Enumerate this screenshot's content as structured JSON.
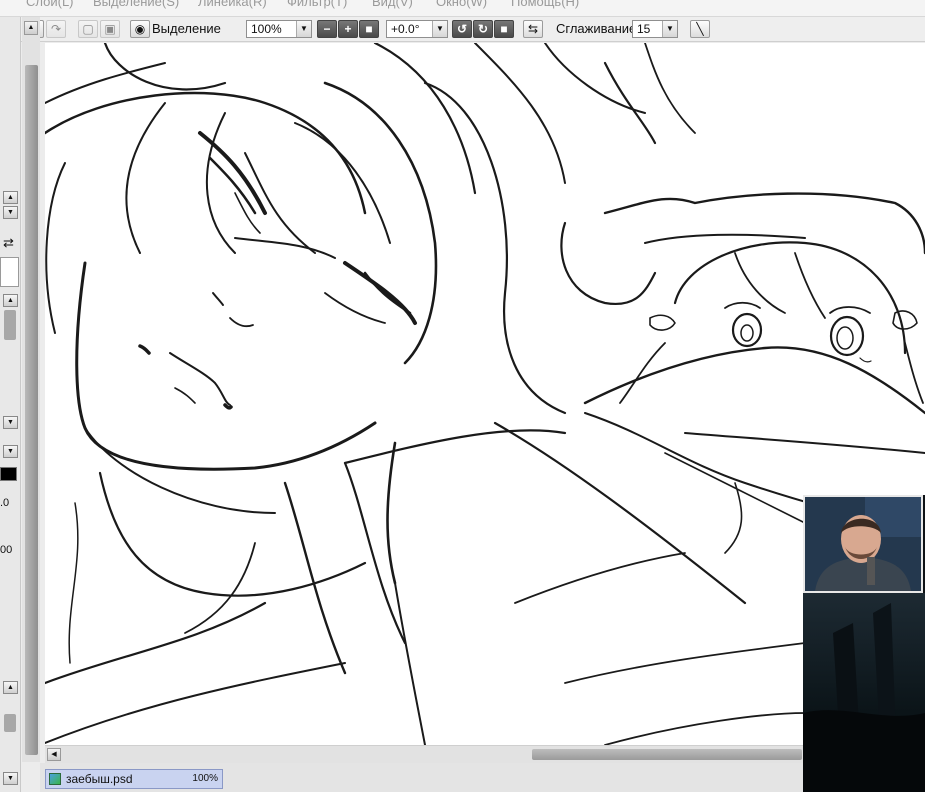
{
  "menubar": {
    "items": [
      "Слои(L)",
      "Выделение(S)",
      "Линейка(R)",
      "Фильтр(T)",
      "Вид(V)",
      "Окно(W)",
      "Помощь(H)"
    ]
  },
  "toolbar": {
    "selection_label": "Выделение",
    "zoom_value": "100%",
    "rotation_value": "+0.0°",
    "smoothing_label": "Сглаживание",
    "smoothing_value": "15"
  },
  "left_panel": {
    "value_1": ".0",
    "value_2": "00"
  },
  "document_tab": {
    "filename": "заебыш.psd",
    "zoom": "100%"
  },
  "icons": {
    "undo": "undo-icon",
    "redo": "redo-icon",
    "eye": "eye-icon",
    "zoom_out": "minus-icon",
    "zoom_in": "plus-icon",
    "rotate_ccw": "rotate-left-icon",
    "rotate_cw": "rotate-right-icon",
    "flip": "flip-horizontal-icon",
    "pen": "pen-stroke-icon"
  },
  "colors": {
    "doc_tab_bg": "#c9d3f0",
    "canvas_bg": "#ffffff",
    "stroke": "#1a1a1a"
  }
}
